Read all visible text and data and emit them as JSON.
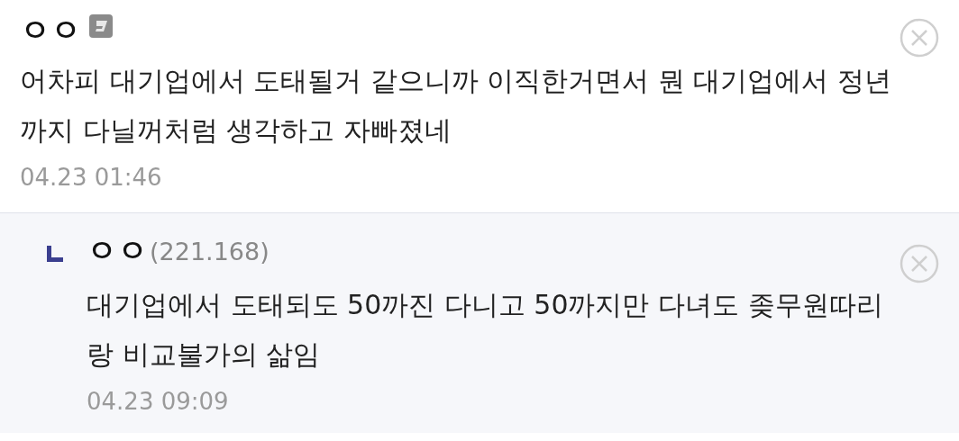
{
  "comments": [
    {
      "kind": "comment",
      "author": "ㅇㅇ",
      "text": "어차피 대기업에서 도태될거 같으니까 이직한거면서 뭔 대기업에서 정년까지 다닐꺼처럼 생각하고 자빠졌네",
      "time": "04.23 01:46"
    },
    {
      "kind": "reply",
      "author": "ㅇㅇ",
      "ip": "(221.168)",
      "text": "대기업에서 도태되도 50까진 다니고 50까지만 다녀도 좆무원따리랑 비교불가의 삶임",
      "time": "04.23 09:09"
    }
  ]
}
